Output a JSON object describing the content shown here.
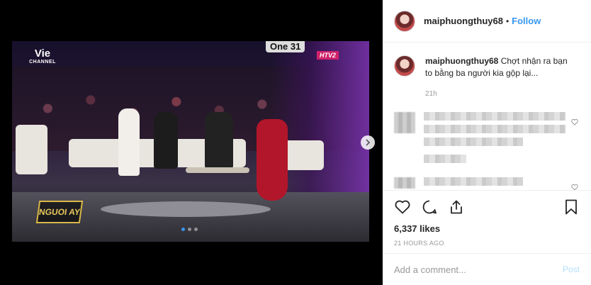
{
  "media": {
    "channel_logo_top": "Vie",
    "channel_logo_bottom": "CHANNEL",
    "broadcaster_logo": "One 31",
    "htv_logo": "HTV2",
    "show_logo": "NGUOI AY",
    "carousel_total": 3,
    "carousel_active": 1
  },
  "header": {
    "username": "maiphuongthuy68",
    "separator": "•",
    "follow_label": "Follow"
  },
  "caption": {
    "username": "maiphuongthuy68",
    "text": "Chợt nhận ra bạn to bằng ba người kia gộp lại...",
    "time": "21h"
  },
  "post": {
    "likes": "6,337 likes",
    "time_ago": "21 HOURS AGO"
  },
  "comment_input": {
    "placeholder": "Add a comment...",
    "post_label": "Post"
  },
  "colors": {
    "accent": "#3897f0",
    "post_disabled": "#b2dffc"
  },
  "icons": [
    "heart-icon",
    "comment-icon",
    "share-icon",
    "bookmark-icon",
    "chevron-right-icon"
  ]
}
